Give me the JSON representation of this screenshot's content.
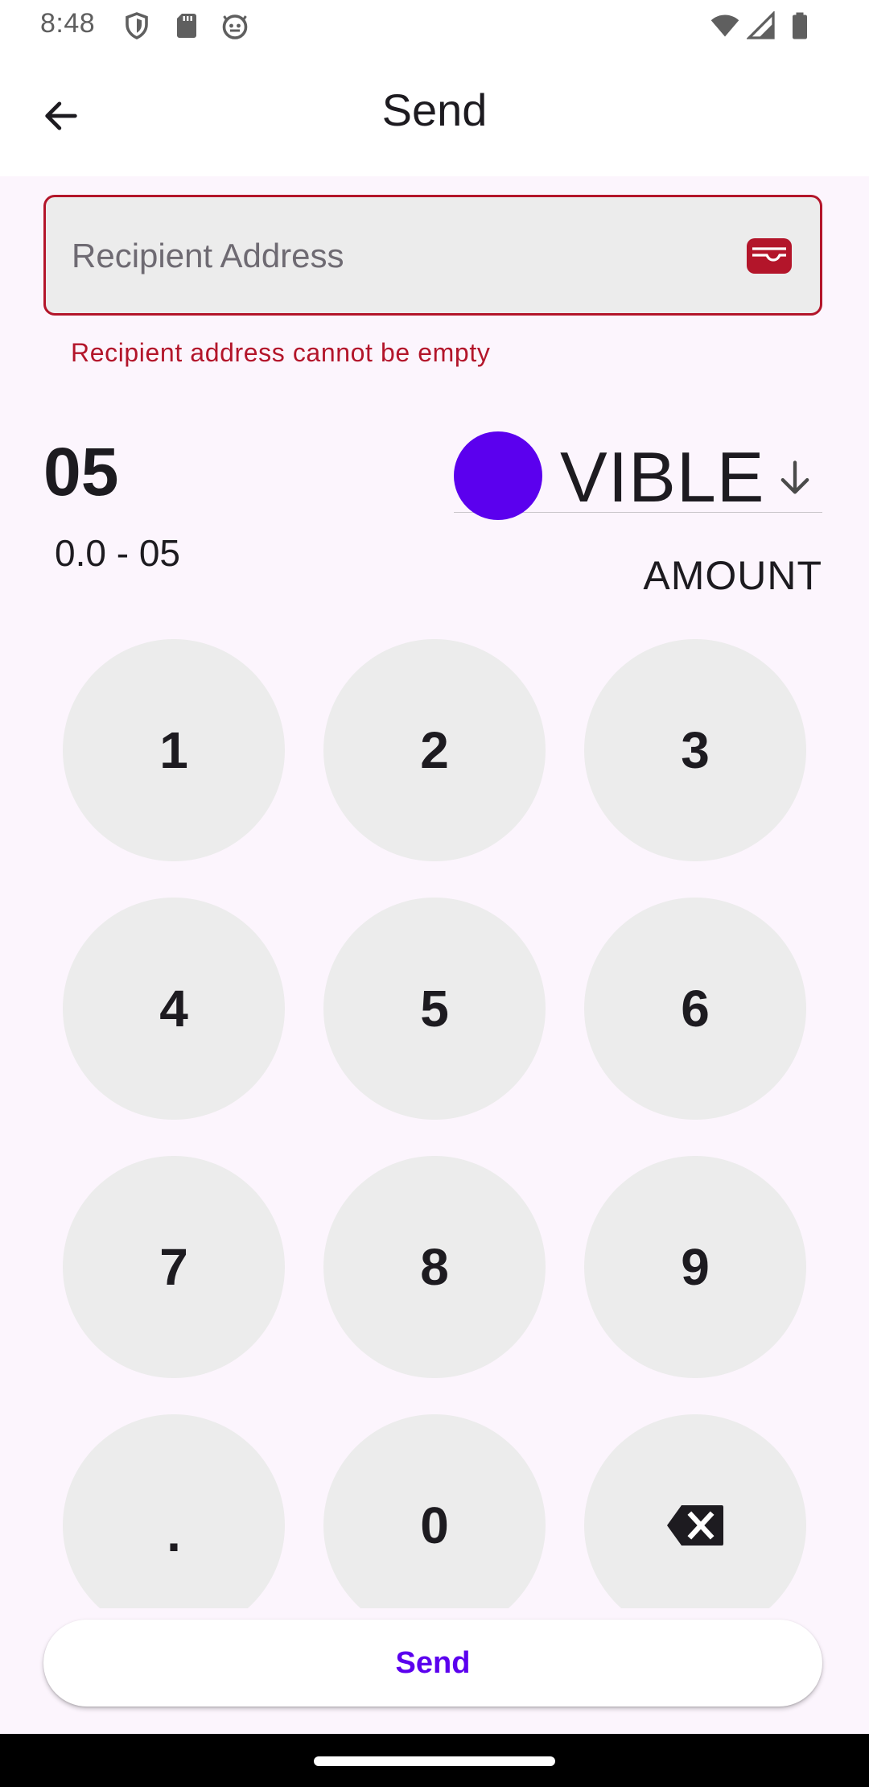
{
  "status_bar": {
    "time": "8:48",
    "left_icons": [
      "shield-icon",
      "sd-card-icon",
      "android-face-icon"
    ],
    "right_icons": [
      "wifi-icon",
      "cell-signal-icon",
      "battery-icon"
    ]
  },
  "app_bar": {
    "title": "Send",
    "back_icon": "arrow-back-icon"
  },
  "recipient": {
    "placeholder": "Recipient Address",
    "value": "",
    "error": "Recipient address cannot be empty",
    "wallet_icon": "wallet-icon"
  },
  "amount": {
    "value": "05",
    "range": "0.0 - 05",
    "label": "AMOUNT"
  },
  "token": {
    "name": "VIBLE",
    "dropdown_icon": "arrow-down-icon"
  },
  "keypad": {
    "keys": [
      "1",
      "2",
      "3",
      "4",
      "5",
      "6",
      "7",
      "8",
      "9",
      ".",
      "0"
    ],
    "backspace_icon": "backspace-icon"
  },
  "send_button": {
    "label": "Send"
  },
  "colors": {
    "accent": "#5b00ee",
    "error": "#b3152a",
    "background": "#fcf5fd",
    "key_background": "#ececec"
  }
}
